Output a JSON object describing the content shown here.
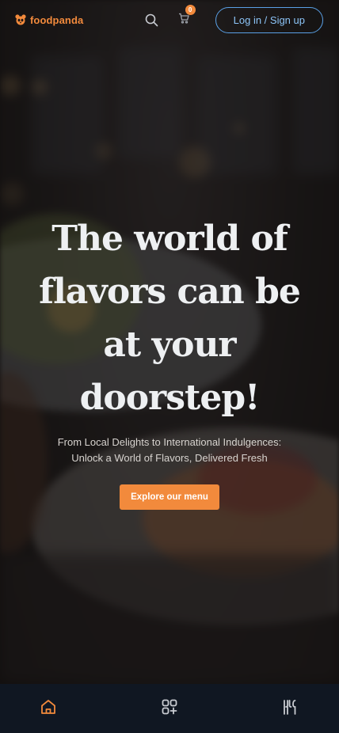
{
  "brand": {
    "name": "foodpanda",
    "accent": "#f28a3c"
  },
  "header": {
    "search_icon": "search-icon",
    "cart": {
      "icon": "cart-icon",
      "count": "0"
    },
    "login_label": "Log in / Sign up",
    "login_color": "#5aa0e6"
  },
  "hero": {
    "title_lines": [
      "The world of",
      "flavors can be",
      "at your",
      "doorstep!"
    ],
    "subtitle_lines": [
      "From Local Delights to International Indulgences:",
      "Unlock a World of Flavors, Delivered Fresh"
    ],
    "cta_label": "Explore our menu",
    "cta_color": "#f28a3c"
  },
  "bottom_nav": {
    "items": [
      {
        "icon": "home-icon",
        "active": true
      },
      {
        "icon": "categories-icon",
        "active": false
      },
      {
        "icon": "menu-utensils-icon",
        "active": false
      }
    ],
    "active_color": "#f28a3c",
    "inactive_color": "#c9ccd2"
  }
}
